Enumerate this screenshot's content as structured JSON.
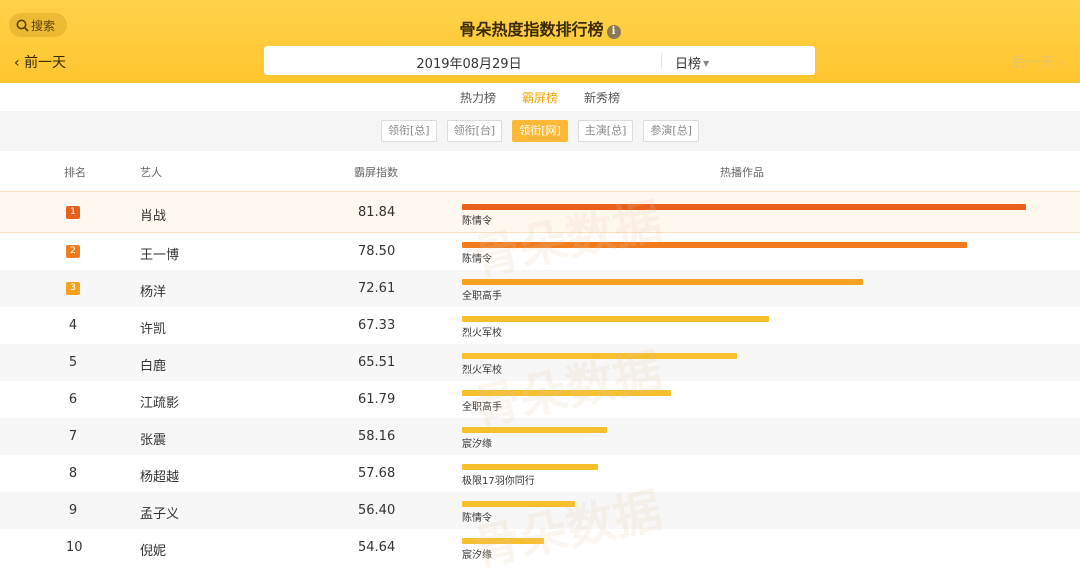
{
  "header": {
    "search_label": "搜索",
    "title": "骨朵热度指数排行榜",
    "info_icon": "info-icon",
    "prev_day": "前一天",
    "next_day": "后一天",
    "date": "2019年08月29日",
    "period": "日榜",
    "colors": {
      "background": "#ffc52e",
      "accent": "#f0a500"
    }
  },
  "tabs": [
    {
      "label": "热力榜",
      "active": false
    },
    {
      "label": "霸屏榜",
      "active": true
    },
    {
      "label": "新秀榜",
      "active": false
    }
  ],
  "filters": [
    {
      "label": "领衔[总]",
      "active": false
    },
    {
      "label": "领衔[台]",
      "active": false
    },
    {
      "label": "领衔[网]",
      "active": true
    },
    {
      "label": "主演[总]",
      "active": false
    },
    {
      "label": "参演[总]",
      "active": false
    }
  ],
  "table": {
    "headers": {
      "rank": "排名",
      "artist": "艺人",
      "score": "霸屏指数",
      "work": "热播作品"
    },
    "max_score": 81.84,
    "rows": [
      {
        "rank": "1",
        "artist": "肖战",
        "score": "81.84",
        "work": "陈情令",
        "color": "#e8601c"
      },
      {
        "rank": "2",
        "artist": "王一博",
        "score": "78.50",
        "work": "陈情令",
        "color": "#f07c1e"
      },
      {
        "rank": "3",
        "artist": "杨洋",
        "score": "72.61",
        "work": "全职高手",
        "color": "#f5a21f"
      },
      {
        "rank": "4",
        "artist": "许凯",
        "score": "67.33",
        "work": "烈火军校",
        "color": "#f7bf2c"
      },
      {
        "rank": "5",
        "artist": "白鹿",
        "score": "65.51",
        "work": "烈火军校",
        "color": "#f7bf2c"
      },
      {
        "rank": "6",
        "artist": "江疏影",
        "score": "61.79",
        "work": "全职高手",
        "color": "#f7bf2c"
      },
      {
        "rank": "7",
        "artist": "张震",
        "score": "58.16",
        "work": "宸汐缘",
        "color": "#f7bf2c"
      },
      {
        "rank": "8",
        "artist": "杨超越",
        "score": "57.68",
        "work": "极限17羽你同行",
        "color": "#f7bf2c"
      },
      {
        "rank": "9",
        "artist": "孟子义",
        "score": "56.40",
        "work": "陈情令",
        "color": "#f7bf2c"
      },
      {
        "rank": "10",
        "artist": "倪妮",
        "score": "54.64",
        "work": "宸汐缘",
        "color": "#f7bf2c"
      }
    ]
  },
  "watermark": "骨朵数据"
}
